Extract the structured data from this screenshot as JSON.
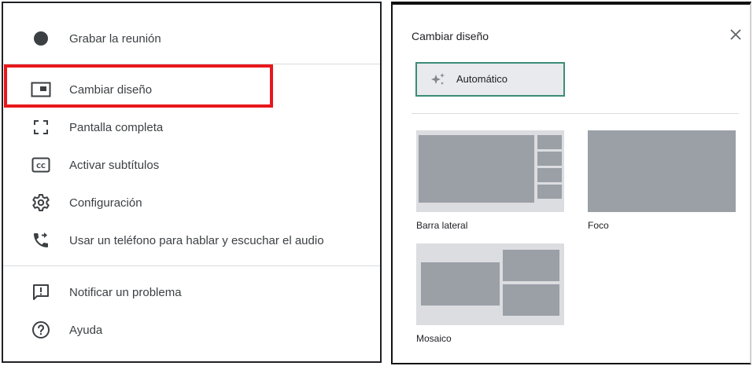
{
  "menu": {
    "items": [
      {
        "id": "record",
        "label": "Grabar la reunión",
        "icon": "record-dot-icon"
      },
      {
        "id": "layout",
        "label": "Cambiar diseño",
        "icon": "layout-icon"
      },
      {
        "id": "fullscreen",
        "label": "Pantalla completa",
        "icon": "fullscreen-icon"
      },
      {
        "id": "captions",
        "label": "Activar subtítulos",
        "icon": "closed-captions-icon"
      },
      {
        "id": "settings",
        "label": "Configuración",
        "icon": "gear-icon"
      },
      {
        "id": "phone",
        "label": "Usar un teléfono para hablar y escuchar el audio",
        "icon": "phone-forward-icon"
      },
      {
        "id": "report",
        "label": "Notificar un problema",
        "icon": "feedback-icon"
      },
      {
        "id": "help",
        "label": "Ayuda",
        "icon": "help-icon"
      }
    ],
    "highlighted_item": "layout",
    "highlight_color": "#e8171b"
  },
  "dialog": {
    "title": "Cambiar diseño",
    "close_icon": "close-icon",
    "auto_option": {
      "label": "Automático",
      "icon": "sparkle-icon",
      "selected": true,
      "border_color": "#3b8c77"
    },
    "layouts": [
      {
        "id": "sidebar",
        "label": "Barra lateral"
      },
      {
        "id": "spotlight",
        "label": "Foco"
      },
      {
        "id": "tiled",
        "label": "Mosaico"
      }
    ]
  }
}
